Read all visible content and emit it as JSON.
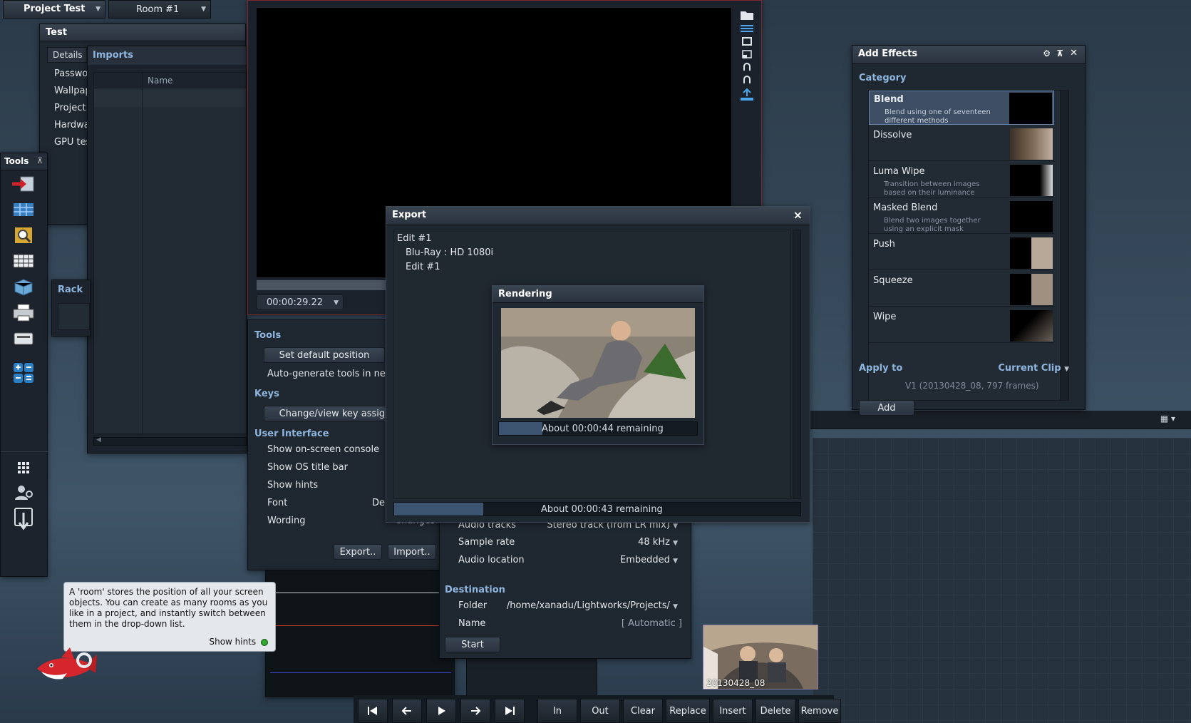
{
  "topbar": {
    "project": "Project Test",
    "room": "Room #1"
  },
  "project_panel": {
    "title": "Test",
    "tabs": [
      "Details",
      "Imports"
    ],
    "side_items": [
      "Passwor",
      "Wallpap",
      "Project",
      "Hardwa",
      "GPU tes"
    ],
    "column": "Name"
  },
  "tools_panel": {
    "title": "Tools"
  },
  "rack": {
    "title": "Rack"
  },
  "viewer": {
    "timecode": "00:00:29.22"
  },
  "settings": {
    "tools_header": "Tools",
    "set_default": "Set default position",
    "auto_gen": "Auto-generate tools in new",
    "keys_header": "Keys",
    "change_keys": "Change/view key assign",
    "ui_header": "User Interface",
    "console": "Show on-screen console",
    "os_title": "Show OS title bar",
    "hints": "Show hints",
    "font": "Font",
    "font_value": "De",
    "wording": "Wording",
    "wording_value": "Changes",
    "export_btn": "Export..",
    "import_btn": "Import.."
  },
  "export_settings": {
    "audio_tracks": "Audio tracks",
    "audio_tracks_value": "Stereo track (from LR mix)",
    "sample_rate": "Sample rate",
    "sample_rate_value": "48 kHz",
    "audio_location": "Audio location",
    "audio_location_value": "Embedded",
    "destination": "Destination",
    "folder": "Folder",
    "folder_value": "/home/xanadu/Lightworks/Projects/",
    "name": "Name",
    "name_value": "[ Automatic ]",
    "start": "Start"
  },
  "export_dialog": {
    "title": "Export",
    "close": "×",
    "tree": [
      "Edit #1",
      "Blu-Ray : HD 1080i",
      "Edit #1"
    ],
    "rendering_title": "Rendering",
    "rendering_remaining": "About 00:00:44 remaining",
    "rendering_progress": 0.22,
    "overall_remaining": "About 00:00:43 remaining",
    "overall_progress": 0.22
  },
  "effects": {
    "title": "Add Effects",
    "category": "Category",
    "items": [
      {
        "name": "Blend",
        "desc1": "Blend using one of seventeen",
        "desc2": "different methods"
      },
      {
        "name": "Dissolve",
        "desc1": "",
        "desc2": ""
      },
      {
        "name": "Luma Wipe",
        "desc1": "Transition between images",
        "desc2": "based on their luminance"
      },
      {
        "name": "Masked Blend",
        "desc1": "Blend two images together",
        "desc2": "using an explicit mask"
      },
      {
        "name": "Push",
        "desc1": "",
        "desc2": ""
      },
      {
        "name": "Squeeze",
        "desc1": "",
        "desc2": ""
      },
      {
        "name": "Wipe",
        "desc1": "",
        "desc2": ""
      }
    ],
    "apply_to": "Apply to",
    "apply_value": "Current Clip",
    "clip_info": "V1 (20130428_08, 797 frames)",
    "add": "Add"
  },
  "hint": {
    "text": "A 'room' stores the position of all your screen objects.  You can create as many rooms as you like in a project, and instantly switch between them in the drop-down list.",
    "toggle": "Show hints"
  },
  "clip": {
    "label": "20130428_08"
  },
  "transport": {
    "buttons": [
      "In",
      "Out",
      "Clear",
      "Replace",
      "Insert",
      "Delete",
      "Remove"
    ]
  },
  "colors": {
    "accent": "#8fb6de",
    "progress": "#3c5470",
    "selected": "#3d4e64"
  }
}
